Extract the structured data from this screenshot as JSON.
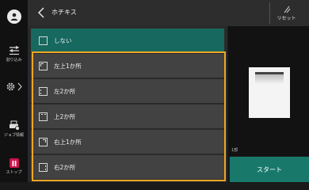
{
  "header": {
    "title": "ホチキス",
    "reset_label": "リセット"
  },
  "sidebar": {
    "scan_label": "割り込み",
    "job_label": "ジョブ情報",
    "stop_label": "ストップ"
  },
  "options": [
    {
      "label": "しない",
      "selected": true
    },
    {
      "label": "左上1か所",
      "selected": false
    },
    {
      "label": "左2か所",
      "selected": false
    },
    {
      "label": "上2か所",
      "selected": false
    },
    {
      "label": "右上1か所",
      "selected": false
    },
    {
      "label": "右2か所",
      "selected": false
    }
  ],
  "preview": {
    "copies": "1部"
  },
  "start_label": "スタート",
  "colors": {
    "selected": "#17685e",
    "highlight": "#f0a623",
    "start": "#18796b",
    "stop": "#d1124a"
  }
}
